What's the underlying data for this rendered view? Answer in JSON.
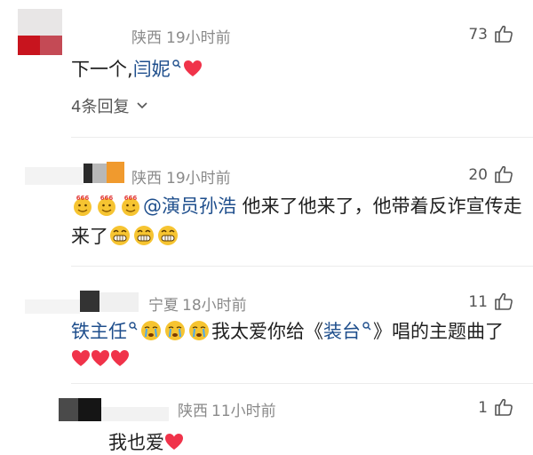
{
  "comments": [
    {
      "location": "陕西",
      "time": "19小时前",
      "likes": "73",
      "text_part1": "下一个,",
      "link1": "闫妮",
      "replies_label": "4条回复"
    },
    {
      "location": "陕西",
      "time": "19小时前",
      "likes": "20",
      "link1": "@演员孙浩",
      "line1_rest": " 他来了他来了，他带着反诈宣传走",
      "line2": "来了"
    },
    {
      "location": "宁夏",
      "time": "18小时前",
      "likes": "11",
      "link1": "铁主任",
      "text_mid": "我太爱你给《",
      "link2": "装台",
      "text_end": "》唱的主题曲了"
    },
    {
      "location": "陕西",
      "time": "11小时前",
      "likes": "1",
      "text_part1": "我也爱"
    }
  ],
  "colors": {
    "link": "#1e4e8c",
    "heart": "#f0334a",
    "meta": "#8a8a8a"
  }
}
